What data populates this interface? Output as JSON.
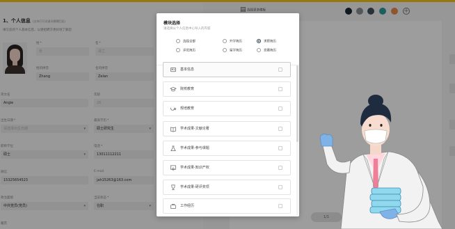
{
  "form": {
    "section_title": "1、个人信息",
    "section_hint": "(支持打开关键词模糊匹配)",
    "section_tip": "填写您的个人基本信息，以便招聘方更好地了解您",
    "fields": [
      {
        "key": "surname",
        "label": "姓",
        "required": true,
        "value": "张",
        "placeholder": true
      },
      {
        "key": "given",
        "label": "名",
        "required": true,
        "value": "泽兰",
        "placeholder": true
      },
      {
        "key": "surname_pinyin",
        "label": "姓的拼音",
        "required": false,
        "value": "Zhang",
        "placeholder": false
      },
      {
        "key": "given_pinyin",
        "label": "名的拼音",
        "required": false,
        "value": "Zelan",
        "placeholder": false
      },
      {
        "key": "english_name",
        "label": "英文名",
        "required": false,
        "value": "Angie",
        "placeholder": false
      },
      {
        "key": "age",
        "label": "年龄",
        "required": false,
        "value": "26",
        "placeholder": true
      },
      {
        "key": "birth",
        "label": "出生日期",
        "required": true,
        "value": "请选择出生日期",
        "placeholder": true
      },
      {
        "key": "degree",
        "label": "最高学历",
        "required": true,
        "value": "硕士研究生",
        "placeholder": false
      },
      {
        "key": "title",
        "label": "职称学位",
        "required": false,
        "value": "硕士",
        "placeholder": false
      },
      {
        "key": "phone",
        "label": "电话",
        "required": true,
        "value": "13011112211",
        "placeholder": false
      },
      {
        "key": "wechat",
        "label": "微信",
        "required": false,
        "value": "15325654523",
        "placeholder": false
      },
      {
        "key": "email",
        "label": "E-mail",
        "required": false,
        "value": "jah15263@163.com",
        "placeholder": false
      },
      {
        "key": "political",
        "label": "政治面貌",
        "required": false,
        "value": "中共党员(党员)",
        "placeholder": false
      },
      {
        "key": "status",
        "label": "当前状态",
        "required": true,
        "value": "在职",
        "placeholder": false
      }
    ],
    "footer_label": "籍贯"
  },
  "right_panel": {
    "toolbar_label": "选择更多模板",
    "toolbar_icon": "template-icon",
    "swatches": [
      "#1c2731",
      "#8a8f94",
      "#454f5a",
      "#2c9c9a",
      "#e58b4b"
    ],
    "add_icon": "plus-circle-icon",
    "pager": "1/1"
  },
  "modal": {
    "title": "模块选择",
    "subtitle": "请选择从个人信息中心导入的内容",
    "options": [
      {
        "label": "选择全部",
        "checked": false
      },
      {
        "label": "升学简历",
        "checked": false
      },
      {
        "label": "求职简历",
        "checked": true
      },
      {
        "label": "评优简历",
        "checked": false
      },
      {
        "label": "留学简历",
        "checked": false
      },
      {
        "label": "竞赛简历",
        "checked": false
      }
    ],
    "modules": [
      {
        "label": "基本信息",
        "icon": "id-card-icon",
        "selected": true
      },
      {
        "label": "院校教育",
        "icon": "graduation-cap-icon",
        "selected": false
      },
      {
        "label": "规培教育",
        "icon": "stethoscope-icon",
        "selected": false
      },
      {
        "label": "学术成果-文献论著",
        "icon": "book-icon",
        "selected": false
      },
      {
        "label": "学术成果-参与课题",
        "icon": "flask-icon",
        "selected": false
      },
      {
        "label": "学术成果-知识产权",
        "icon": "certificate-icon",
        "selected": false
      },
      {
        "label": "学术成果-研评奖项",
        "icon": "trophy-icon",
        "selected": false
      },
      {
        "label": "工作经历",
        "icon": "briefcase-icon",
        "selected": false
      }
    ]
  }
}
